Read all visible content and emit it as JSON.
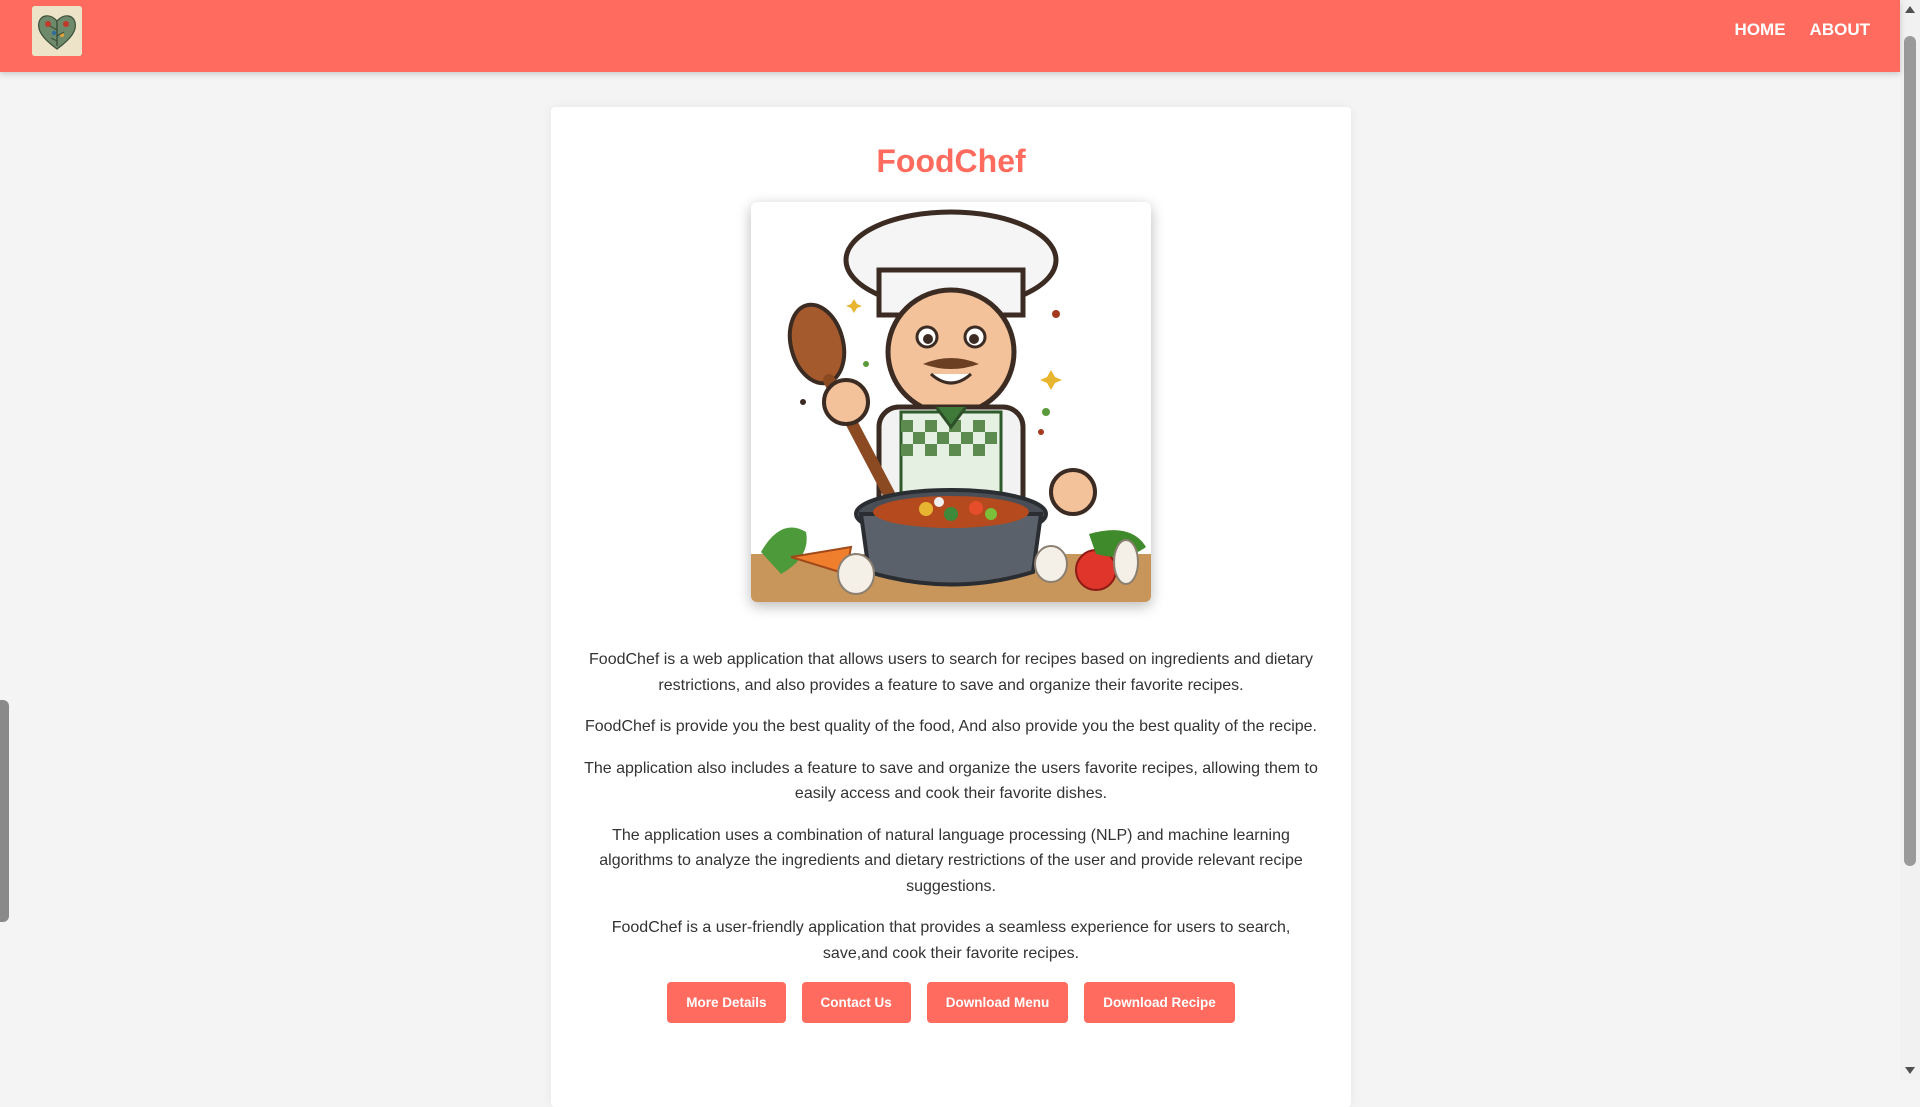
{
  "nav": {
    "logo_icon": "heart-leaf-logo-icon",
    "links": [
      "HOME",
      "ABOUT"
    ]
  },
  "main": {
    "title": "FoodChef",
    "hero_icon": "chef-cooking-illustration",
    "paragraphs": [
      "FoodChef is a web application that allows users to search for recipes based on ingredients and dietary restrictions, and also provides a feature to save and organize their favorite recipes.",
      "FoodChef is provide you the best quality of the food, And also provide you the best quality of the recipe.",
      "The application also includes a feature to save and organize the users favorite recipes, allowing them to easily access and cook their favorite dishes.",
      "The application uses a combination of natural language processing (NLP) and machine learning algorithms to analyze the ingredients and dietary restrictions of the user and provide relevant recipe suggestions.",
      "FoodChef is a user-friendly application that provides a seamless experience for users to search, save,and cook their favorite recipes."
    ],
    "buttons": [
      "More Details",
      "Contact Us",
      "Download Menu",
      "Download Recipe"
    ]
  },
  "colors": {
    "brand": "#ff6b5e",
    "background": "#f4f4f4",
    "card": "#ffffff",
    "text": "#333333"
  }
}
